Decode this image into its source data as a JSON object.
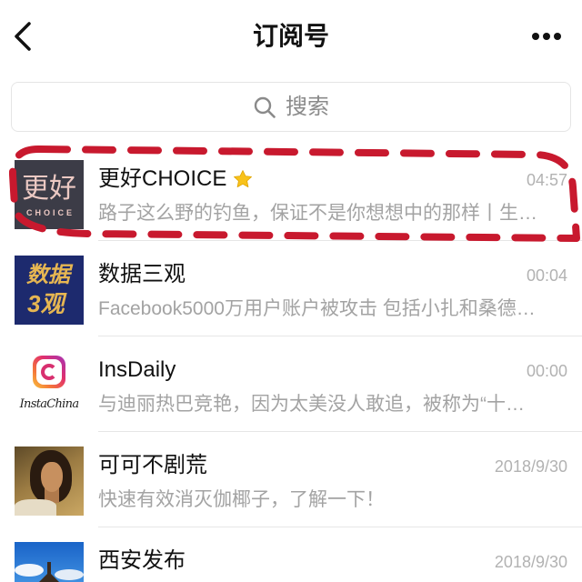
{
  "header": {
    "title": "订阅号",
    "back_icon": "chevron-left-icon",
    "more_icon": "more-icon"
  },
  "search": {
    "placeholder": "搜索",
    "icon": "search-icon"
  },
  "accounts": [
    {
      "name": "更好CHOICE",
      "badge_icon": "star-icon",
      "time": "04:57",
      "preview": "路子这么野的钓鱼，保证不是你想想中的那样丨生…",
      "avatar_text": [
        "更好",
        "CHOICE"
      ]
    },
    {
      "name": "数据三观",
      "time": "00:04",
      "preview": "Facebook5000万用户账户被攻击 包括小扎和桑德…",
      "avatar_text": [
        "数据",
        "3观"
      ]
    },
    {
      "name": "InsDaily",
      "time": "00:00",
      "preview": "与迪丽热巴竞艳，因为太美没人敢追，被称为“十…",
      "avatar_text": [
        "InstaChina"
      ]
    },
    {
      "name": "可可不剧荒",
      "time": "2018/9/30",
      "preview": "快速有效消灭伽椰子，了解一下！"
    },
    {
      "name": "西安发布",
      "time": "2018/9/30"
    }
  ],
  "colors": {
    "highlight": "#c8192e",
    "text": "#111111",
    "secondary": "#a3a3a3",
    "time": "#b2b2b2",
    "divider": "#e6e6e6",
    "star": "#f8c21b",
    "choice_bg": "#3c3c47",
    "choice_fg": "#ecc9c3",
    "sanguan_bg": "#1d2a6e",
    "sanguan_fg": "#e6b652"
  }
}
